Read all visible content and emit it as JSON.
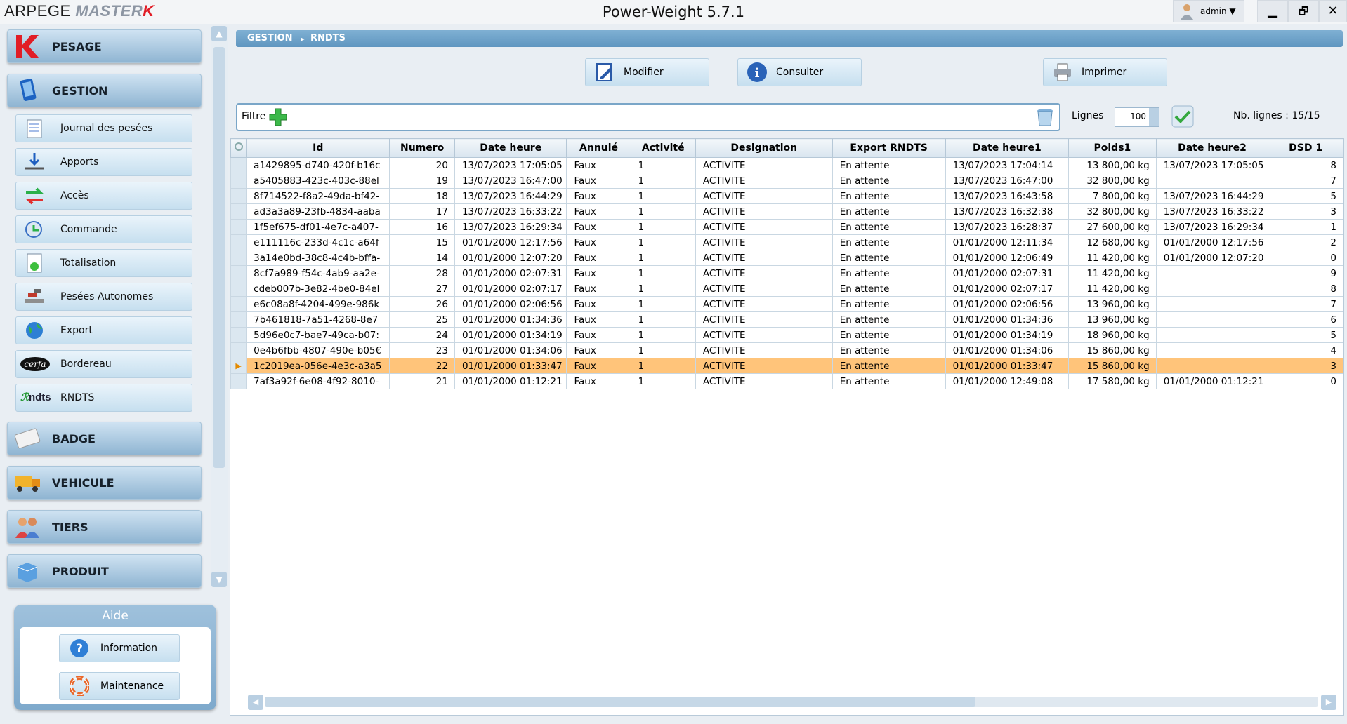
{
  "app": {
    "logo_part1": "ARPEGE ",
    "logo_part2": "MASTER",
    "logo_part3": "K",
    "title": "Power-Weight 5.7.1",
    "user": "admin ▼",
    "minimize": "▁",
    "restore": "🗗",
    "close": "✕"
  },
  "sidebar": {
    "categories": [
      {
        "label": "PESAGE",
        "icon": "k-logo-icon"
      },
      {
        "label": "GESTION",
        "icon": "tablet-icon"
      },
      {
        "label": "BADGE",
        "icon": "badge-card-icon"
      },
      {
        "label": "VEHICULE",
        "icon": "truck-icon"
      },
      {
        "label": "TIERS",
        "icon": "people-icon"
      },
      {
        "label": "PRODUIT",
        "icon": "box-icon"
      }
    ],
    "items": [
      {
        "label": "Journal des pesées",
        "icon": "notebook-icon"
      },
      {
        "label": "Apports",
        "icon": "inbound-arrow-icon"
      },
      {
        "label": "Accès",
        "icon": "swap-arrows-icon"
      },
      {
        "label": "Commande",
        "icon": "order-icon"
      },
      {
        "label": "Totalisation",
        "icon": "totalisation-icon"
      },
      {
        "label": "Pesées Autonomes",
        "icon": "autonomous-scale-icon"
      },
      {
        "label": "Export",
        "icon": "globe-icon"
      },
      {
        "label": "Bordereau",
        "icon": "cerfa-icon"
      },
      {
        "label": "RNDTS",
        "icon": "rndts-icon"
      }
    ],
    "cerfa_text": "cerfa",
    "rndts_text": "ndts",
    "aide": {
      "title": "Aide",
      "information": "Information",
      "maintenance": "Maintenance"
    }
  },
  "breadcrumb": {
    "level1": "GESTION",
    "sep": "▸",
    "level2": "RNDTS"
  },
  "toolbar": {
    "modifier": "Modifier",
    "consulter": "Consulter",
    "imprimer": "Imprimer"
  },
  "filter": {
    "label": "Filtre"
  },
  "lignes": {
    "label": "Lignes",
    "value": "100"
  },
  "nb_lignes": "Nb.  lignes : 15/15",
  "colors": {
    "accent": "#6a9fc8",
    "selected_row": "#ffc47a"
  },
  "table": {
    "columns": [
      "Id",
      "Numero",
      "Date heure",
      "Annulé",
      "Activité",
      "Designation",
      "Export RNDTS",
      "Date heure1",
      "Poids1",
      "Date heure2",
      "DSD 1"
    ],
    "rows": [
      [
        "a1429895-d740-420f-b16c",
        "20",
        "13/07/2023 17:05:05",
        "Faux",
        "1",
        "ACTIVITE",
        "En attente",
        "13/07/2023 17:04:14",
        "13 800,00 kg",
        "13/07/2023 17:05:05",
        "8"
      ],
      [
        "a5405883-423c-403c-88el",
        "19",
        "13/07/2023 16:47:00",
        "Faux",
        "1",
        "ACTIVITE",
        "En attente",
        "13/07/2023 16:47:00",
        "32 800,00 kg",
        "",
        "7"
      ],
      [
        "8f714522-f8a2-49da-bf42-",
        "18",
        "13/07/2023 16:44:29",
        "Faux",
        "1",
        "ACTIVITE",
        "En attente",
        "13/07/2023 16:43:58",
        "7 800,00 kg",
        "13/07/2023 16:44:29",
        "5"
      ],
      [
        "ad3a3a89-23fb-4834-aaba",
        "17",
        "13/07/2023 16:33:22",
        "Faux",
        "1",
        "ACTIVITE",
        "En attente",
        "13/07/2023 16:32:38",
        "32 800,00 kg",
        "13/07/2023 16:33:22",
        "3"
      ],
      [
        "1f5ef675-df01-4e7c-a407-",
        "16",
        "13/07/2023 16:29:34",
        "Faux",
        "1",
        "ACTIVITE",
        "En attente",
        "13/07/2023 16:28:37",
        "27 600,00 kg",
        "13/07/2023 16:29:34",
        "1"
      ],
      [
        "e111116c-233d-4c1c-a64f",
        "15",
        "01/01/2000 12:17:56",
        "Faux",
        "1",
        "ACTIVITE",
        "En attente",
        "01/01/2000 12:11:34",
        "12 680,00 kg",
        "01/01/2000 12:17:56",
        "2"
      ],
      [
        "3a14e0bd-38c8-4c4b-bffa-",
        "14",
        "01/01/2000 12:07:20",
        "Faux",
        "1",
        "ACTIVITE",
        "En attente",
        "01/01/2000 12:06:49",
        "11 420,00 kg",
        "01/01/2000 12:07:20",
        "0"
      ],
      [
        "8cf7a989-f54c-4ab9-aa2e-",
        "28",
        "01/01/2000 02:07:31",
        "Faux",
        "1",
        "ACTIVITE",
        "En attente",
        "01/01/2000 02:07:31",
        "11 420,00 kg",
        "",
        "9"
      ],
      [
        "cdeb007b-3e82-4be0-84el",
        "27",
        "01/01/2000 02:07:17",
        "Faux",
        "1",
        "ACTIVITE",
        "En attente",
        "01/01/2000 02:07:17",
        "11 420,00 kg",
        "",
        "8"
      ],
      [
        "e6c08a8f-4204-499e-986k",
        "26",
        "01/01/2000 02:06:56",
        "Faux",
        "1",
        "ACTIVITE",
        "En attente",
        "01/01/2000 02:06:56",
        "13 960,00 kg",
        "",
        "7"
      ],
      [
        "7b461818-7a51-4268-8e7",
        "25",
        "01/01/2000 01:34:36",
        "Faux",
        "1",
        "ACTIVITE",
        "En attente",
        "01/01/2000 01:34:36",
        "13 960,00 kg",
        "",
        "6"
      ],
      [
        "5d96e0c7-bae7-49ca-b07:",
        "24",
        "01/01/2000 01:34:19",
        "Faux",
        "1",
        "ACTIVITE",
        "En attente",
        "01/01/2000 01:34:19",
        "18 960,00 kg",
        "",
        "5"
      ],
      [
        "0e4b6fbb-4807-490e-b05€",
        "23",
        "01/01/2000 01:34:06",
        "Faux",
        "1",
        "ACTIVITE",
        "En attente",
        "01/01/2000 01:34:06",
        "15 860,00 kg",
        "",
        "4"
      ],
      [
        "1c2019ea-056e-4e3c-a3a5",
        "22",
        "01/01/2000 01:33:47",
        "Faux",
        "1",
        "ACTIVITE",
        "En attente",
        "01/01/2000 01:33:47",
        "15 860,00 kg",
        "",
        "3"
      ],
      [
        "7af3a92f-6e08-4f92-8010-",
        "21",
        "01/01/2000 01:12:21",
        "Faux",
        "1",
        "ACTIVITE",
        "En attente",
        "01/01/2000 12:49:08",
        "17 580,00 kg",
        "01/01/2000 01:12:21",
        "0"
      ]
    ],
    "selected_row": 13,
    "row_marker": "▶"
  }
}
